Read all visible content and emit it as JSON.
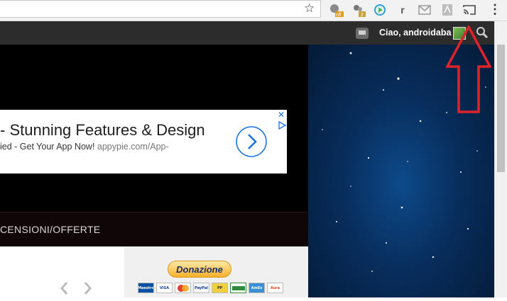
{
  "browser": {
    "toolbar": {
      "bookmark_icon": "star-icon",
      "extensions": [
        {
          "name": "extension-1",
          "badge": "off"
        },
        {
          "name": "extension-2",
          "badge": "2"
        },
        {
          "name": "play-extension",
          "badge": ""
        },
        {
          "name": "r-extension",
          "badge": "r"
        },
        {
          "name": "mail-extension",
          "badge": ""
        },
        {
          "name": "pdf-extension",
          "badge": ""
        },
        {
          "name": "cast-extension",
          "badge": ""
        }
      ]
    }
  },
  "header": {
    "greeting": "Ciao, androidaba"
  },
  "ad": {
    "title": "- Stunning Features & Design",
    "subtitle": "ied - Get Your App Now!",
    "url": "appypie.com/App-"
  },
  "nav": {
    "item_label": "CENSIONI/OFFERTE"
  },
  "sidebar": {
    "donate_label": "Donazione",
    "cards": [
      {
        "label": "Maestro",
        "color": "#0b4fa3"
      },
      {
        "label": "VISA",
        "color": "#1a3fa0"
      },
      {
        "label": "MC",
        "color": "#e33b2e"
      },
      {
        "label": "PayPal",
        "color": "#e8e8e8"
      },
      {
        "label": "PP",
        "color": "#f0d040"
      },
      {
        "label": "Bank",
        "color": "#2e8b3e"
      },
      {
        "label": "AmEx",
        "color": "#3a8fd6"
      },
      {
        "label": "Aura",
        "color": "#e04a1a"
      }
    ]
  },
  "colors": {
    "accent_red": "#e0222a",
    "header_bg": "#2c2c2c"
  }
}
